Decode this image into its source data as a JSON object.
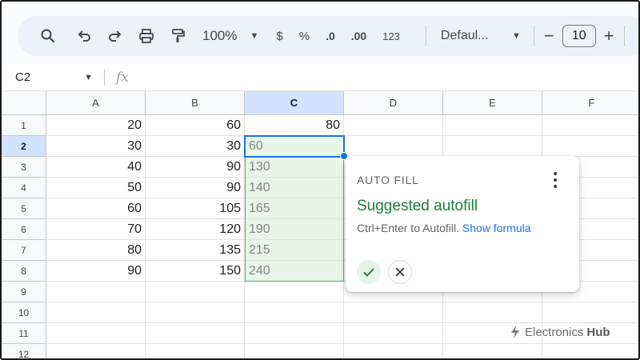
{
  "toolbar": {
    "icons": [
      "search-icon",
      "undo-icon",
      "redo-icon",
      "print-icon",
      "paint-format-icon"
    ],
    "zoom": "100%",
    "currency_label": "$",
    "percent_label": "%",
    "decrease_decimal_label": ".0",
    "increase_decimal_label": ".00",
    "number_format_label": "123",
    "font": "Defaul...",
    "minus_label": "−",
    "font_size": "10",
    "plus_label": "+"
  },
  "formula_bar": {
    "name_box": "C2",
    "fx_label": "fx"
  },
  "grid": {
    "columns": [
      "A",
      "B",
      "C",
      "D",
      "E",
      "F"
    ],
    "selected_column": "C",
    "rows": [
      "1",
      "2",
      "3",
      "4",
      "5",
      "6",
      "7",
      "8",
      "9",
      "10",
      "11",
      "12"
    ],
    "selected_row": "2",
    "col_a": [
      "20",
      "30",
      "40",
      "50",
      "60",
      "70",
      "80",
      "90"
    ],
    "col_b": [
      "60",
      "30",
      "90",
      "90",
      "105",
      "120",
      "135",
      "150"
    ],
    "col_c_value": "80",
    "col_c_suggested": [
      "60",
      "130",
      "140",
      "165",
      "190",
      "215",
      "240"
    ]
  },
  "autofill": {
    "title": "AUTO FILL",
    "heading": "Suggested autofill",
    "description": "Ctrl+Enter to Autofill.",
    "link": "Show formula",
    "accent_color": "#188038"
  },
  "watermark": {
    "text": "Electronics",
    "bold_text": "Hub"
  }
}
